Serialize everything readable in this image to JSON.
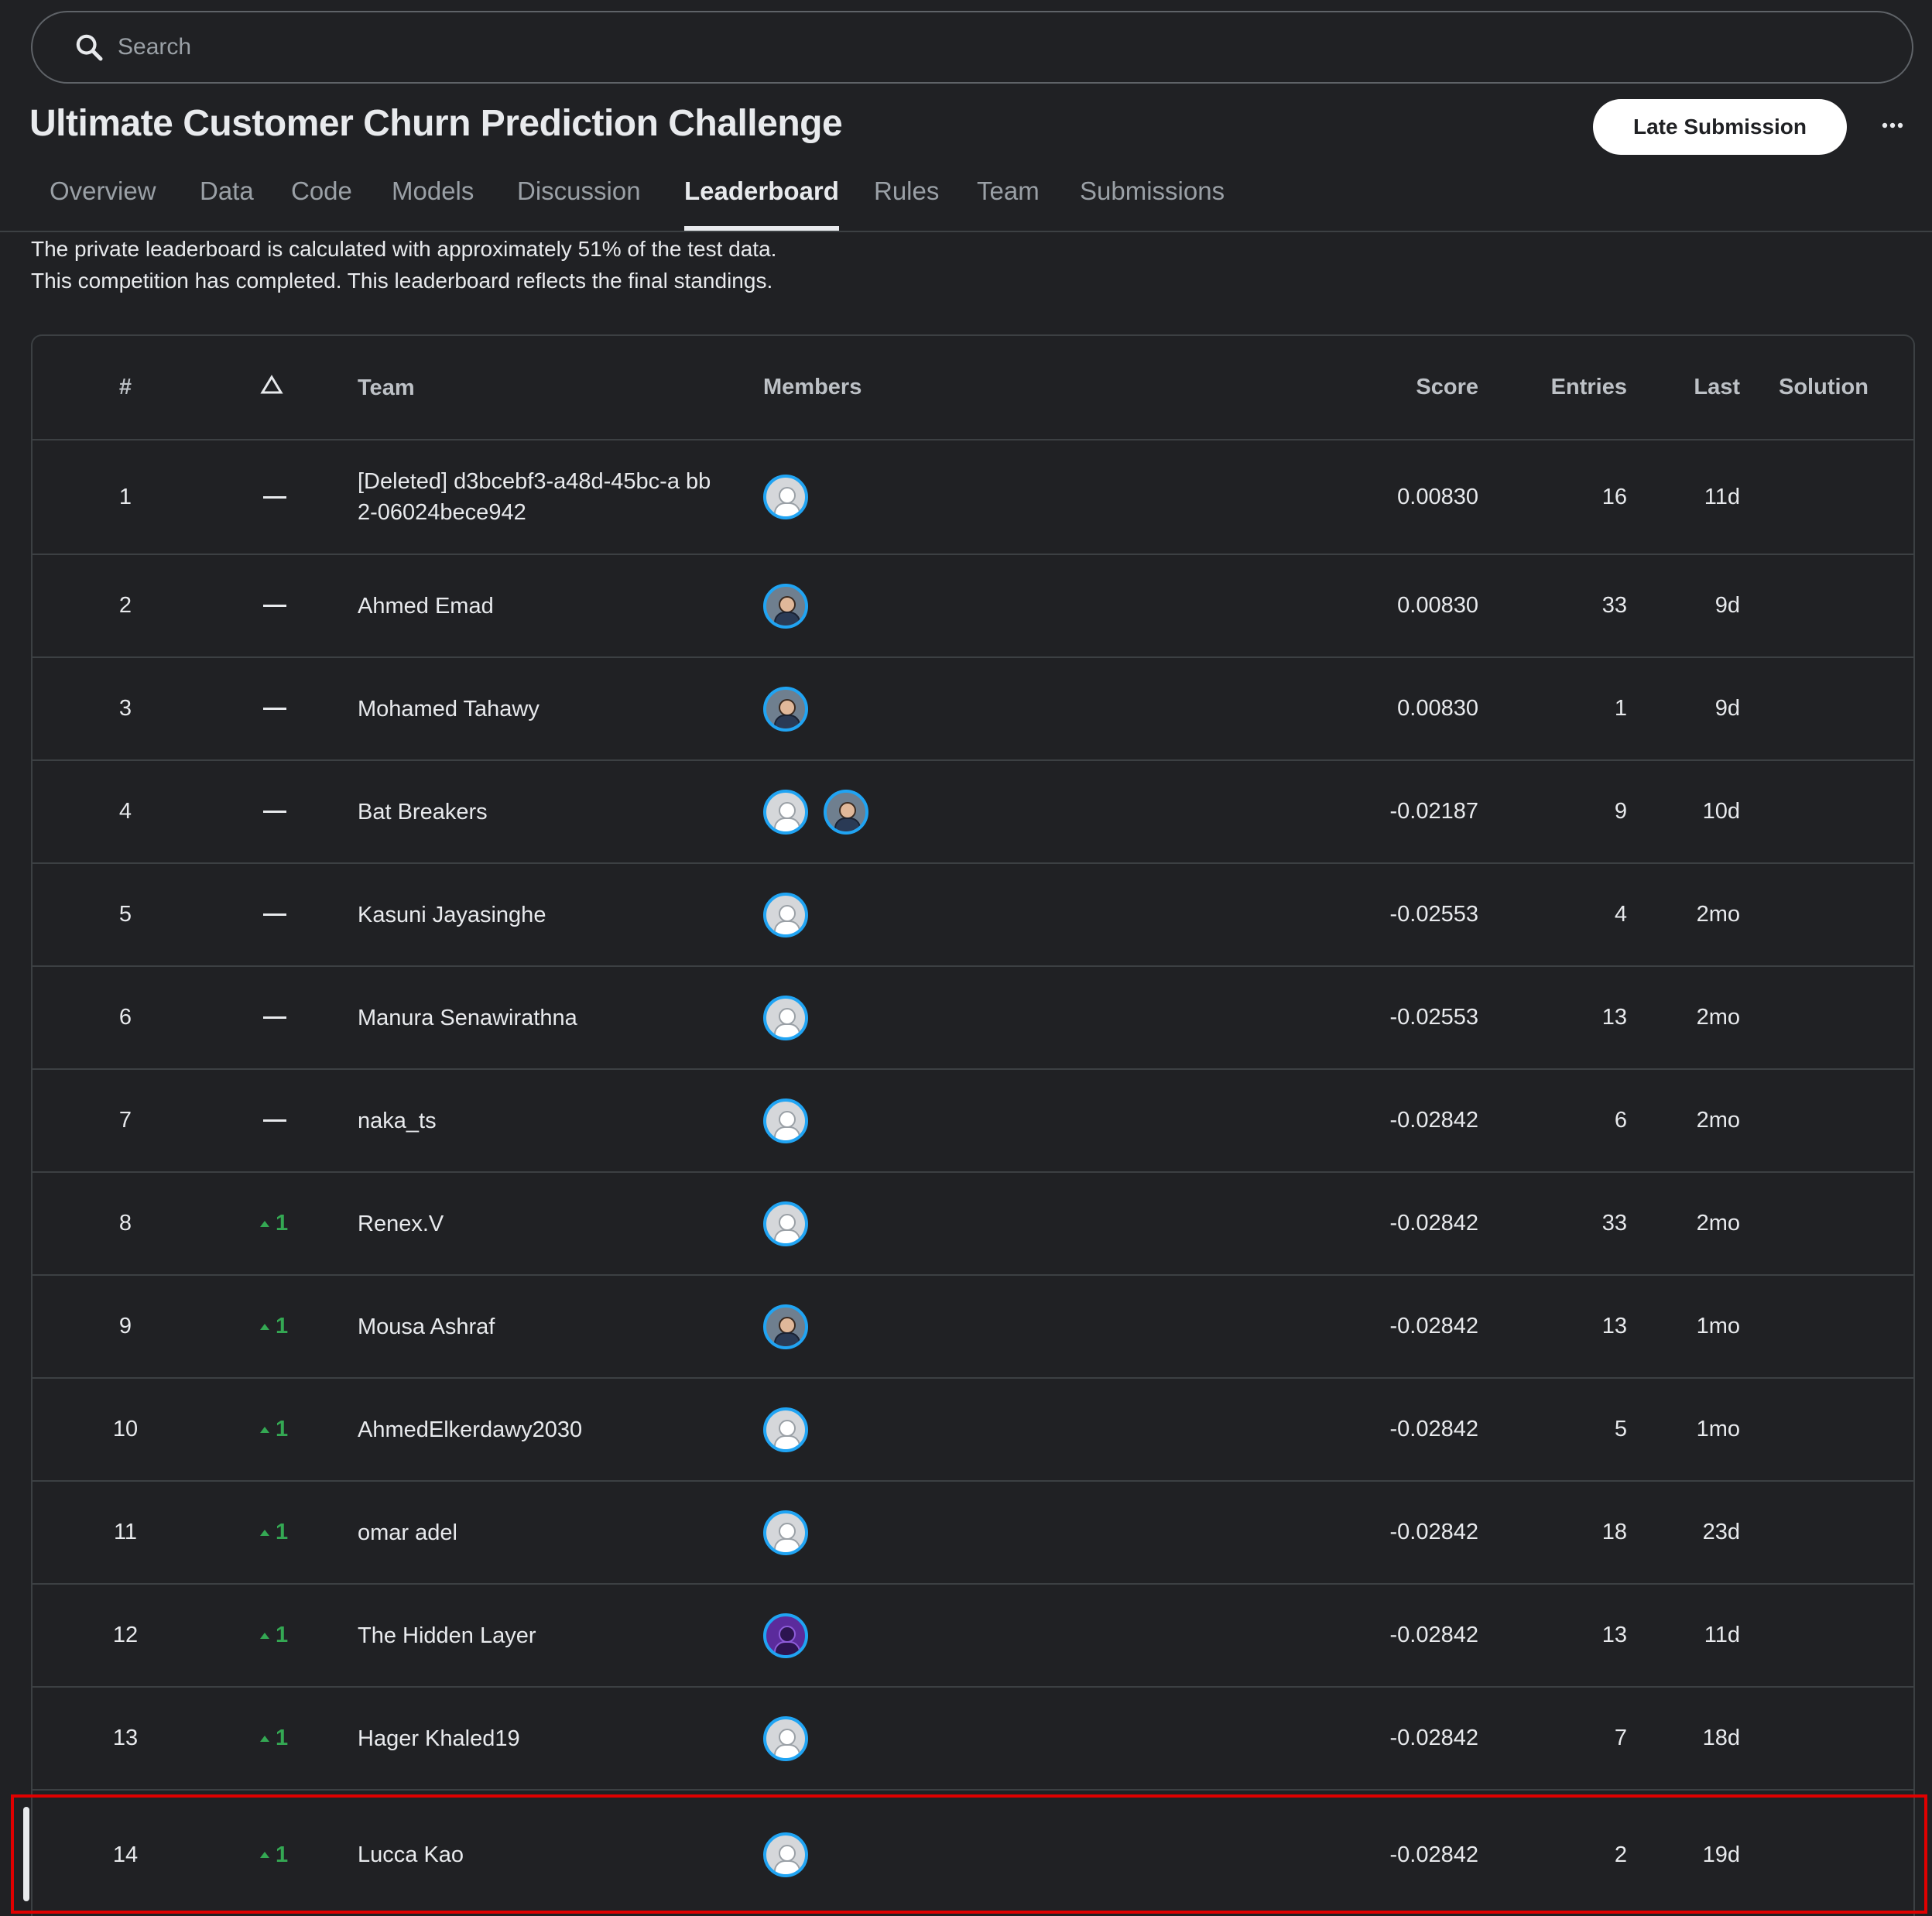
{
  "search": {
    "placeholder": "Search"
  },
  "competition": {
    "title": "Ultimate Customer Churn Prediction Challenge"
  },
  "actions": {
    "late_submission_label": "Late Submission",
    "more_label": "···"
  },
  "tabs": [
    {
      "label": "Overview"
    },
    {
      "label": "Data"
    },
    {
      "label": "Code"
    },
    {
      "label": "Models"
    },
    {
      "label": "Discussion"
    },
    {
      "label": "Leaderboard",
      "active": true
    },
    {
      "label": "Rules"
    },
    {
      "label": "Team"
    },
    {
      "label": "Submissions"
    }
  ],
  "notes": {
    "line1": "The private leaderboard is calculated with approximately 51% of the test data.",
    "line2": "This competition has completed. This leaderboard reflects the final standings."
  },
  "table": {
    "headers": {
      "rank": "#",
      "delta": "△",
      "team": "Team",
      "members": "Members",
      "score": "Score",
      "entries": "Entries",
      "last": "Last",
      "solution": "Solution"
    },
    "rows": [
      {
        "rank": "1",
        "delta": "",
        "team": "[Deleted] d3bcebf3-a48d-45bc-a bb2-06024bece942",
        "score": "0.00830",
        "entries": "16",
        "last": "11d"
      },
      {
        "rank": "2",
        "delta": "",
        "team": "Ahmed Emad",
        "score": "0.00830",
        "entries": "33",
        "last": "9d"
      },
      {
        "rank": "3",
        "delta": "",
        "team": "Mohamed Tahawy",
        "score": "0.00830",
        "entries": "1",
        "last": "9d"
      },
      {
        "rank": "4",
        "delta": "",
        "team": "Bat Breakers",
        "score": "-0.02187",
        "entries": "9",
        "last": "10d"
      },
      {
        "rank": "5",
        "delta": "",
        "team": "Kasuni Jayasinghe",
        "score": "-0.02553",
        "entries": "4",
        "last": "2mo"
      },
      {
        "rank": "6",
        "delta": "",
        "team": "Manura Senawirathna",
        "score": "-0.02553",
        "entries": "13",
        "last": "2mo"
      },
      {
        "rank": "7",
        "delta": "",
        "team": "naka_ts",
        "score": "-0.02842",
        "entries": "6",
        "last": "2mo"
      },
      {
        "rank": "8",
        "delta": "1",
        "team": "Renex.V",
        "score": "-0.02842",
        "entries": "33",
        "last": "2mo"
      },
      {
        "rank": "9",
        "delta": "1",
        "team": "Mousa Ashraf",
        "score": "-0.02842",
        "entries": "13",
        "last": "1mo"
      },
      {
        "rank": "10",
        "delta": "1",
        "team": "AhmedElkerdawy2030",
        "score": "-0.02842",
        "entries": "5",
        "last": "1mo"
      },
      {
        "rank": "11",
        "delta": "1",
        "team": "omar adel",
        "score": "-0.02842",
        "entries": "18",
        "last": "23d"
      },
      {
        "rank": "12",
        "delta": "1",
        "team": "The Hidden Layer",
        "score": "-0.02842",
        "entries": "13",
        "last": "11d"
      },
      {
        "rank": "13",
        "delta": "1",
        "team": "Hager Khaled19",
        "score": "-0.02842",
        "entries": "7",
        "last": "18d"
      },
      {
        "rank": "14",
        "delta": "1",
        "team": "Lucca Kao",
        "score": "-0.02842",
        "entries": "2",
        "last": "19d"
      }
    ]
  }
}
